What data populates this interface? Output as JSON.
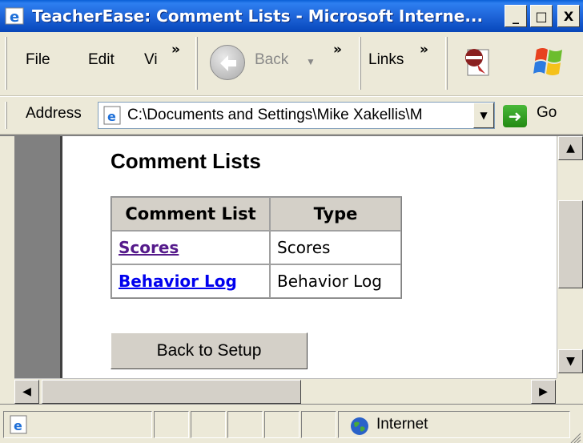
{
  "window": {
    "title": "TeacherEase: Comment Lists - Microsoft Interne...",
    "minimize": "_",
    "maximize": "□",
    "close": "X"
  },
  "menu": {
    "file": "File",
    "edit": "Edit",
    "view": "Vi",
    "back": "Back",
    "links": "Links",
    "more": "»"
  },
  "address": {
    "label": "Address",
    "value": "C:\\Documents and Settings\\Mike Xakellis\\M",
    "go": "Go"
  },
  "page": {
    "title": "Comment Lists",
    "table": {
      "headers": [
        "Comment List",
        "Type"
      ],
      "rows": [
        {
          "name": "Scores",
          "type": "Scores"
        },
        {
          "name": "Behavior Log",
          "type": "Behavior Log"
        }
      ]
    },
    "back_button": "Back to Setup"
  },
  "status": {
    "zone": "Internet"
  }
}
